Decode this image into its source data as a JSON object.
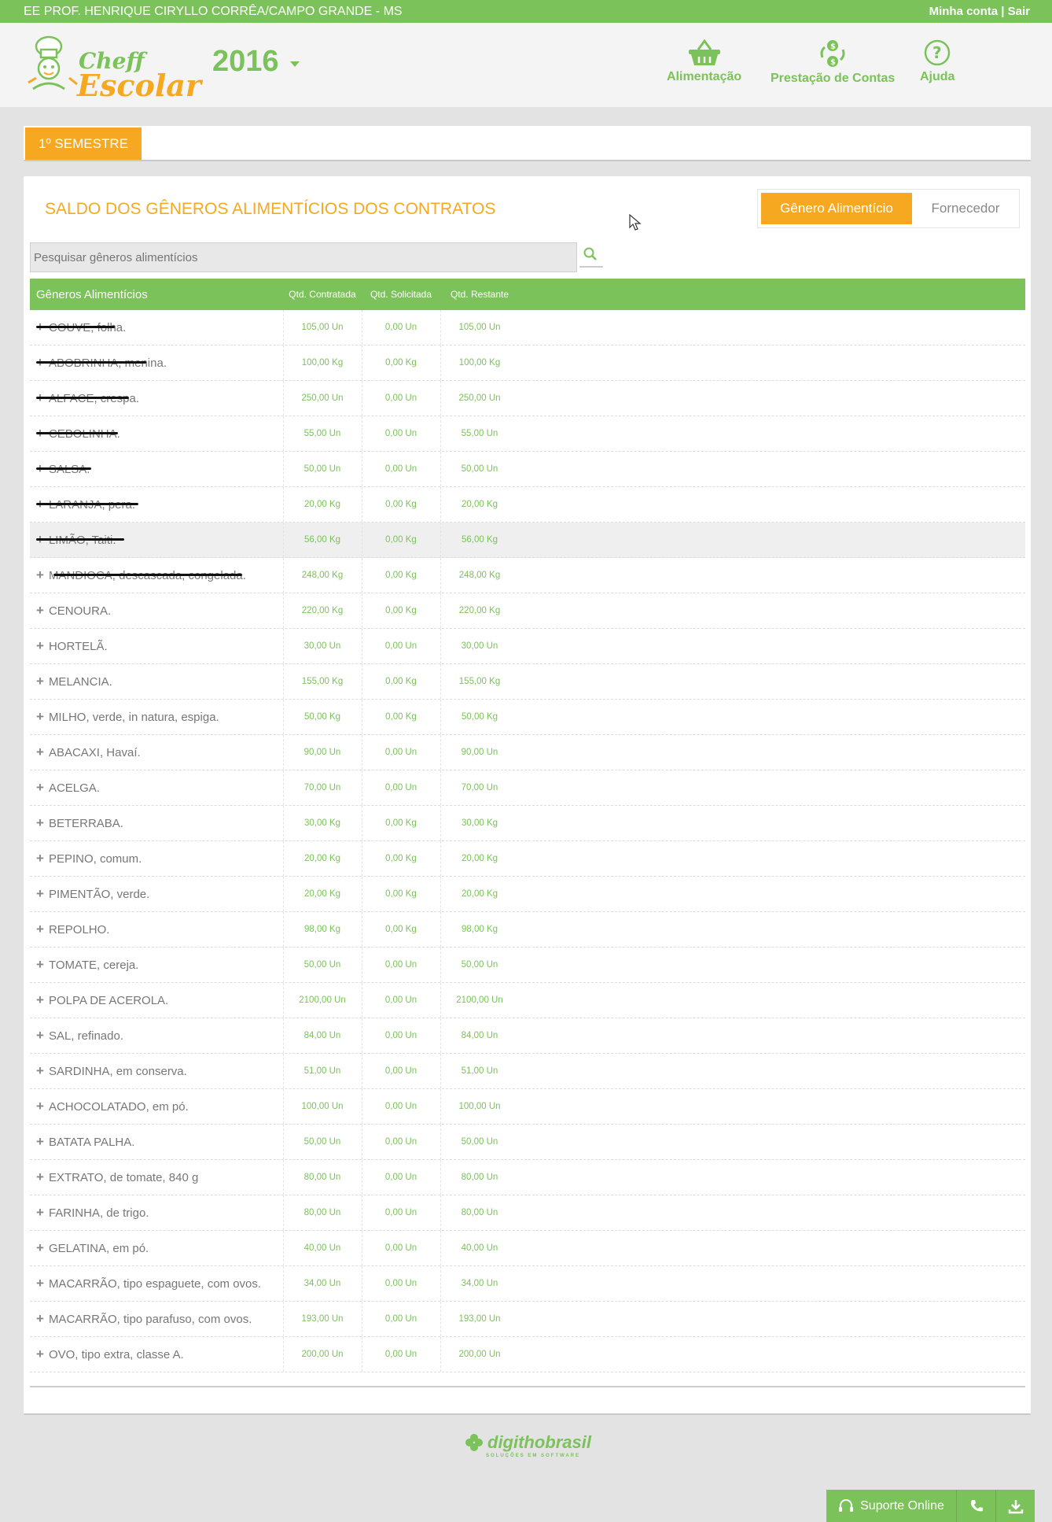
{
  "topbar": {
    "school": "EE PROF. HENRIQUE CIRYLLO CORRÊA/CAMPO GRANDE - MS",
    "my_account": "Minha conta",
    "separator": " | ",
    "logout": "Sair"
  },
  "header": {
    "logo_line1": "Cheff",
    "logo_line2": "Escolar",
    "year": "2016",
    "nav": {
      "food": "Alimentação",
      "accounts": "Prestação de Contas",
      "help": "Ajuda"
    }
  },
  "semester": {
    "label": "1º SEMESTRE"
  },
  "card": {
    "title": "SALDO DOS GÊNEROS ALIMENTÍCIOS DOS CONTRATOS",
    "toggle_food": "Gênero Alimentício",
    "toggle_supplier": "Fornecedor",
    "search_placeholder": "Pesquisar gêneros alimentícios"
  },
  "table": {
    "headers": {
      "name": "Gêneros Alimentícios",
      "contracted": "Qtd. Contratada",
      "requested": "Qtd. Solicitada",
      "remaining": "Qtd. Restante"
    },
    "rows": [
      {
        "name": "COUVE, folha.",
        "contracted": "105,00 Un",
        "requested": "0,00 Un",
        "remaining": "105,00 Un"
      },
      {
        "name": "ABOBRINHA, menina.",
        "contracted": "100,00 Kg",
        "requested": "0,00 Kg",
        "remaining": "100,00 Kg"
      },
      {
        "name": "ALFACE, crespa.",
        "contracted": "250,00 Un",
        "requested": "0,00 Un",
        "remaining": "250,00 Un"
      },
      {
        "name": "CEBOLINHA.",
        "contracted": "55,00 Un",
        "requested": "0,00 Un",
        "remaining": "55,00 Un"
      },
      {
        "name": "SALSA.",
        "contracted": "50,00 Un",
        "requested": "0,00 Un",
        "remaining": "50,00 Un"
      },
      {
        "name": "LARANJA, pera.",
        "contracted": "20,00 Kg",
        "requested": "0,00 Kg",
        "remaining": "20,00 Kg"
      },
      {
        "name": "LIMÃO, Taiti.",
        "contracted": "56,00 Kg",
        "requested": "0,00 Kg",
        "remaining": "56,00 Kg"
      },
      {
        "name": "MANDIOCA, descascada, congelada.",
        "contracted": "248,00 Kg",
        "requested": "0,00 Kg",
        "remaining": "248,00 Kg"
      },
      {
        "name": "CENOURA.",
        "contracted": "220,00 Kg",
        "requested": "0,00 Kg",
        "remaining": "220,00 Kg"
      },
      {
        "name": "HORTELÃ.",
        "contracted": "30,00 Un",
        "requested": "0,00 Un",
        "remaining": "30,00 Un"
      },
      {
        "name": "MELANCIA.",
        "contracted": "155,00 Kg",
        "requested": "0,00 Kg",
        "remaining": "155,00 Kg"
      },
      {
        "name": "MILHO, verde, in natura, espiga.",
        "contracted": "50,00 Kg",
        "requested": "0,00 Kg",
        "remaining": "50,00 Kg"
      },
      {
        "name": "ABACAXI, Havaí.",
        "contracted": "90,00 Un",
        "requested": "0,00 Un",
        "remaining": "90,00 Un"
      },
      {
        "name": "ACELGA.",
        "contracted": "70,00 Un",
        "requested": "0,00 Un",
        "remaining": "70,00 Un"
      },
      {
        "name": "BETERRABA.",
        "contracted": "30,00 Kg",
        "requested": "0,00 Kg",
        "remaining": "30,00 Kg"
      },
      {
        "name": "PEPINO, comum.",
        "contracted": "20,00 Kg",
        "requested": "0,00 Kg",
        "remaining": "20,00 Kg"
      },
      {
        "name": "PIMENTÃO, verde.",
        "contracted": "20,00 Kg",
        "requested": "0,00 Kg",
        "remaining": "20,00 Kg"
      },
      {
        "name": "REPOLHO.",
        "contracted": "98,00 Kg",
        "requested": "0,00 Kg",
        "remaining": "98,00 Kg"
      },
      {
        "name": "TOMATE, cereja.",
        "contracted": "50,00 Un",
        "requested": "0,00 Un",
        "remaining": "50,00 Un"
      },
      {
        "name": "POLPA DE ACEROLA.",
        "contracted": "2100,00 Un",
        "requested": "0,00 Un",
        "remaining": "2100,00 Un"
      },
      {
        "name": "SAL, refinado.",
        "contracted": "84,00 Un",
        "requested": "0,00 Un",
        "remaining": "84,00 Un"
      },
      {
        "name": "SARDINHA, em conserva.",
        "contracted": "51,00 Un",
        "requested": "0,00 Un",
        "remaining": "51,00 Un"
      },
      {
        "name": "ACHOCOLATADO, em pó.",
        "contracted": "100,00 Un",
        "requested": "0,00 Un",
        "remaining": "100,00 Un"
      },
      {
        "name": "BATATA PALHA.",
        "contracted": "50,00 Un",
        "requested": "0,00 Un",
        "remaining": "50,00 Un"
      },
      {
        "name": "EXTRATO, de tomate, 840 g",
        "contracted": "80,00 Un",
        "requested": "0,00 Un",
        "remaining": "80,00 Un"
      },
      {
        "name": "FARINHA, de trigo.",
        "contracted": "80,00 Un",
        "requested": "0,00 Un",
        "remaining": "80,00 Un"
      },
      {
        "name": "GELATINA, em pó.",
        "contracted": "40,00 Un",
        "requested": "0,00 Un",
        "remaining": "40,00 Un"
      },
      {
        "name": "MACARRÃO, tipo espaguete, com ovos.",
        "contracted": "34,00 Un",
        "requested": "0,00 Un",
        "remaining": "34,00 Un"
      },
      {
        "name": "MACARRÃO, tipo parafuso, com ovos.",
        "contracted": "193,00 Un",
        "requested": "0,00 Un",
        "remaining": "193,00 Un"
      },
      {
        "name": "OVO, tipo extra, classe A.",
        "contracted": "200,00 Un",
        "requested": "0,00 Un",
        "remaining": "200,00 Un"
      }
    ]
  },
  "footer": {
    "brand": "digithobrasil",
    "tagline": "SOLUÇÕES EM SOFTWARE",
    "support": "Suporte Online"
  },
  "colors": {
    "green": "#7bc25a",
    "orange": "#f6a821"
  }
}
